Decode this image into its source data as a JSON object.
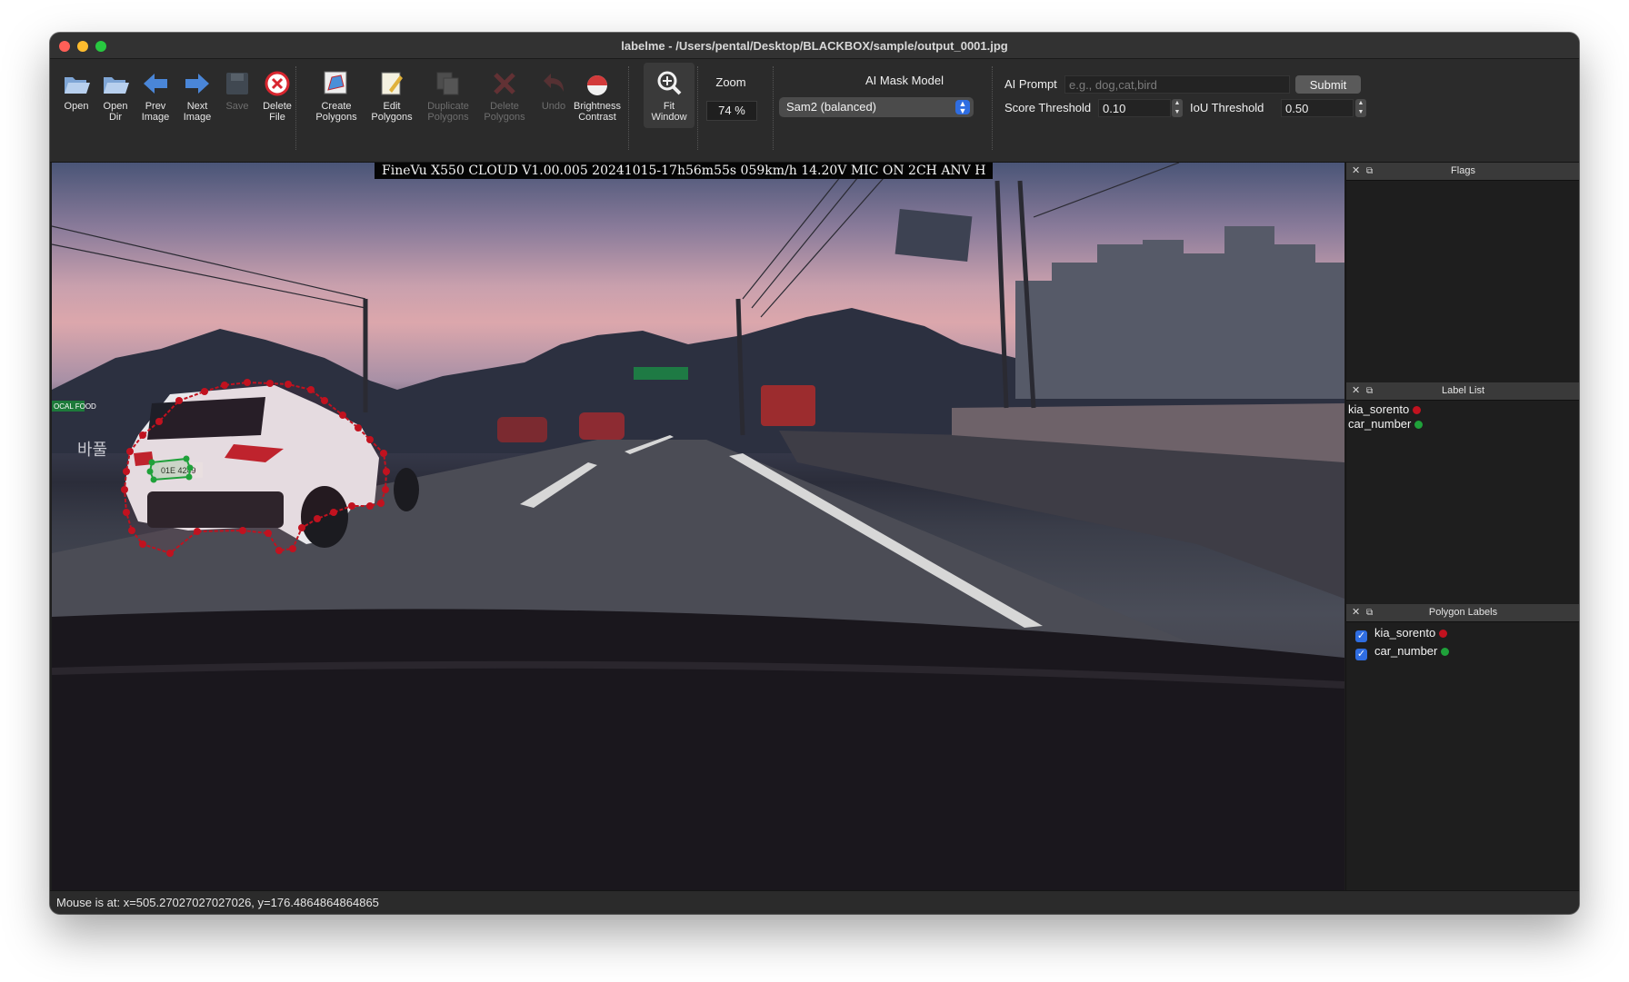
{
  "window": {
    "title": "labelme - /Users/pental/Desktop/BLACKBOX/sample/output_0001.jpg"
  },
  "toolbar": {
    "tools": [
      {
        "label": "Open",
        "icon": "folder-open-icon",
        "enabled": true
      },
      {
        "label": "Open\nDir",
        "icon": "folder-open-dir-icon",
        "enabled": true
      },
      {
        "label": "Prev\nImage",
        "icon": "arrow-left-icon",
        "enabled": true
      },
      {
        "label": "Next\nImage",
        "icon": "arrow-right-icon",
        "enabled": true
      },
      {
        "label": "Save",
        "icon": "save-disk-icon",
        "enabled": false
      },
      {
        "label": "Delete\nFile",
        "icon": "delete-file-icon",
        "enabled": true
      },
      {
        "label": "Create\nPolygons",
        "icon": "create-polygon-icon",
        "enabled": true
      },
      {
        "label": "Edit\nPolygons",
        "icon": "edit-polygon-icon",
        "enabled": true
      },
      {
        "label": "Duplicate\nPolygons",
        "icon": "duplicate-icon",
        "enabled": false
      },
      {
        "label": "Delete\nPolygons",
        "icon": "delete-polygon-icon",
        "enabled": false
      },
      {
        "label": "Undo",
        "icon": "undo-icon",
        "enabled": false
      },
      {
        "label": "Brightness\nContrast",
        "icon": "brightness-icon",
        "enabled": true
      },
      {
        "label": "Fit\nWindow",
        "icon": "fit-window-icon",
        "enabled": true
      }
    ],
    "zoom_label": "Zoom",
    "zoom_value": "74 %",
    "ai_model_label": "AI Mask Model",
    "ai_model_value": "Sam2 (balanced)",
    "ai_prompt_label": "AI Prompt",
    "ai_prompt_placeholder": "e.g., dog,cat,bird",
    "submit_label": "Submit",
    "score_threshold_label": "Score Threshold",
    "score_threshold_value": "0.10",
    "iou_threshold_label": "IoU Threshold",
    "iou_threshold_value": "0.50"
  },
  "canvas": {
    "overlay_text": "FineVu X550 CLOUD V1.00.005 20241015-17h56m55s 059km/h 14.20V MIC  ON 2CH ANV H",
    "sign_text": "바풀",
    "shop_sign_text": "OCAL FOOD",
    "plate_text": "01E 4249"
  },
  "docks": {
    "flags_title": "Flags",
    "label_list_title": "Label List",
    "polygon_labels_title": "Polygon Labels",
    "labels": [
      {
        "name": "kia_sorento",
        "color": "#c1121f"
      },
      {
        "name": "car_number",
        "color": "#1fa13a"
      }
    ],
    "polygon_labels": [
      {
        "name": "kia_sorento",
        "color": "#c1121f",
        "checked": true
      },
      {
        "name": "car_number",
        "color": "#1fa13a",
        "checked": true
      }
    ]
  },
  "status": {
    "text": "Mouse is at: x=505.27027027027026, y=176.4864864864865"
  },
  "colors": {
    "polygon_red": "#c1121f",
    "polygon_green": "#1fa13a",
    "accent_blue": "#2f6de1"
  }
}
